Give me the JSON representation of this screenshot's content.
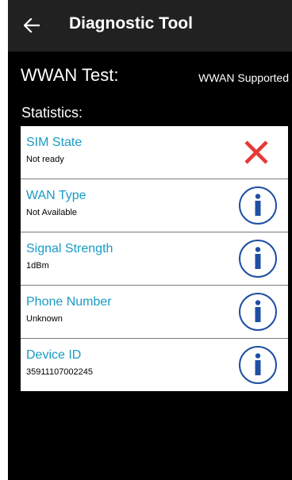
{
  "app_bar": {
    "back_icon": "arrow-left-icon",
    "title": "Diagnostic Tool"
  },
  "test": {
    "title": "WWAN Test:",
    "status": "WWAN Supported"
  },
  "statistics": {
    "label": "Statistics:",
    "items": [
      {
        "name": "SIM State",
        "value": "Not ready",
        "icon": "close-icon",
        "icon_color": "#e53935"
      },
      {
        "name": "WAN Type",
        "value": "Not Available",
        "icon": "info-icon",
        "icon_color": "#1e4fa3"
      },
      {
        "name": "Signal Strength",
        "value": "1dBm",
        "icon": "info-icon",
        "icon_color": "#1e4fa3"
      },
      {
        "name": "Phone Number",
        "value": "Unknown",
        "icon": "info-icon",
        "icon_color": "#1e4fa3"
      },
      {
        "name": "Device ID",
        "value": "35911107002245",
        "icon": "info-icon",
        "icon_color": "#1e4fa3"
      }
    ]
  },
  "colors": {
    "app_bar_bg": "#212121",
    "background": "#000000",
    "stat_name": "#1a9bc4"
  }
}
